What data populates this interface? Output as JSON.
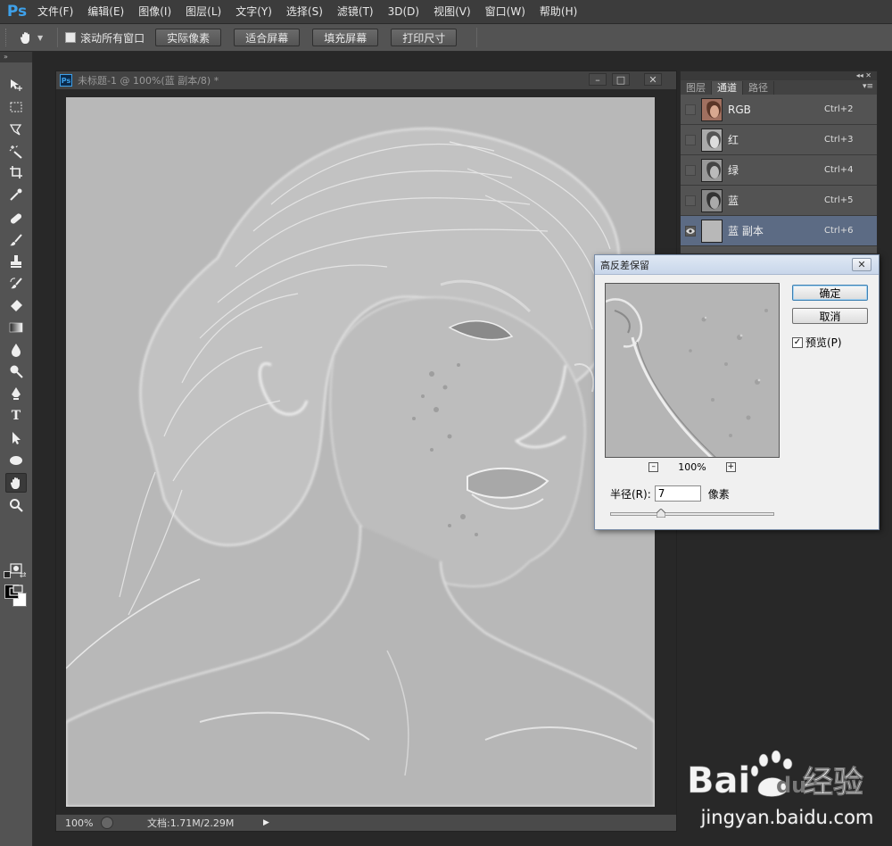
{
  "app": {
    "logo": "Ps"
  },
  "menu": [
    {
      "label": "文件(F)"
    },
    {
      "label": "编辑(E)"
    },
    {
      "label": "图像(I)"
    },
    {
      "label": "图层(L)"
    },
    {
      "label": "文字(Y)"
    },
    {
      "label": "选择(S)"
    },
    {
      "label": "滤镜(T)"
    },
    {
      "label": "3D(D)"
    },
    {
      "label": "视图(V)"
    },
    {
      "label": "窗口(W)"
    },
    {
      "label": "帮助(H)"
    }
  ],
  "options": {
    "scroll_all": "滚动所有窗口",
    "actual_pixels": "实际像素",
    "fit_screen": "适合屏幕",
    "fill_screen": "填充屏幕",
    "print_size": "打印尺寸"
  },
  "document": {
    "title": "未标题-1 @ 100%(蓝 副本/8) *",
    "ps_icon": "Ps",
    "zoom": "100%",
    "doc_info": "文档:1.71M/2.29M"
  },
  "panel": {
    "tabs": [
      {
        "label": "图层"
      },
      {
        "label": "通道"
      },
      {
        "label": "路径"
      }
    ],
    "channels": [
      {
        "name": "RGB",
        "shortcut": "Ctrl+2"
      },
      {
        "name": "红",
        "shortcut": "Ctrl+3"
      },
      {
        "name": "绿",
        "shortcut": "Ctrl+4"
      },
      {
        "name": "蓝",
        "shortcut": "Ctrl+5"
      },
      {
        "name": "蓝 副本",
        "shortcut": "Ctrl+6"
      }
    ]
  },
  "dialog": {
    "title": "高反差保留",
    "ok": "确定",
    "cancel": "取消",
    "preview": "预览(P)",
    "preview_checked": "✓",
    "zoom": "100%",
    "radius_label": "半径(R):",
    "radius_value": "7",
    "radius_unit": "像素"
  },
  "watermark": {
    "brand": "Bai经验",
    "url": "jingyan.baidu.com"
  },
  "colors": {
    "ui_dark": "#535353",
    "selected_row": "#5c6b84",
    "ps_blue": "#3ea1ea"
  }
}
